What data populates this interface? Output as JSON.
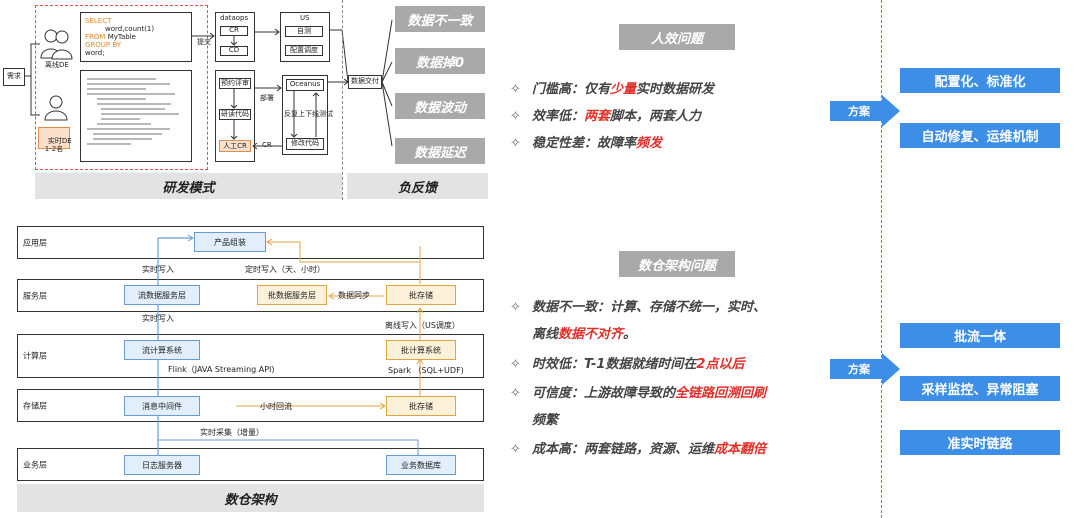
{
  "dev_mode": {
    "request": "需求",
    "offline_de": "离线DE",
    "realtime_de": "实时DE\n1-2名",
    "sql": {
      "l1": "SELECT",
      "l2": "word,count(1)",
      "l3": "FROM",
      "l3b": "MyTable",
      "l4": "GROUP BY",
      "l5": "word;"
    },
    "submit": "提交",
    "deploy": "部署",
    "dataops": "dataops",
    "cr": "CR",
    "cd": "CD",
    "us": "US",
    "self_test": "自测",
    "config_schedule": "配置调度",
    "pre_review": "预约评审",
    "study_code": "研读代码",
    "manual_cr": "人工CR",
    "cr_arrow": "CR",
    "oceanus": "Oceanus",
    "updown_test": "反复上下线测试",
    "modify_code": "修改代码",
    "data_delivery": "数据交付",
    "caption": "研发模式"
  },
  "negative_feedback": {
    "items": [
      "数据不一致",
      "数据掉0",
      "数据波动",
      "数据延迟"
    ],
    "caption": "负反馈"
  },
  "architecture": {
    "layers": [
      "应用层",
      "服务层",
      "计算层",
      "存储层",
      "业务层"
    ],
    "product_assembly": "产品组装",
    "stream_service": "流数据服务层",
    "batch_service": "批数据服务层",
    "batch_storage_top": "批存储",
    "stream_compute": "流计算系统",
    "batch_compute": "批计算系统",
    "message_middleware": "消息中间件",
    "batch_storage_bottom": "批存储",
    "log_server": "日志服务器",
    "biz_db": "业务数据库",
    "realtime_write_1": "实时写入",
    "scheduled_write": "定时写入（天、小时）",
    "data_sync": "数据同步",
    "realtime_write_2": "实时写入",
    "offline_write": "离线写入（US调度）",
    "flink": "Flink（JAVA Streaming API)",
    "spark": "Spark （SQL+UDF)",
    "hourly_backflow": "小时回流",
    "realtime_collect": "实时采集（增量）",
    "caption": "数仓架构"
  },
  "efficiency": {
    "title": "人效问题",
    "b1_pre": "门槛高：仅有",
    "b1_red": "少量",
    "b1_post": "实时数据研发",
    "b2_pre": "效率低：",
    "b2_red": "两套",
    "b2_post": "脚本，两套人力",
    "b3_pre": "稳定性差：故障率",
    "b3_red": "频发"
  },
  "dw_problems": {
    "title": "数仓架构问题",
    "b1_l1": "数据不一致：计算、存储不统一，实时、",
    "b1_l2_pre": "离线",
    "b1_l2_red": "数据不对齐",
    "b1_l2_post": "。",
    "b2_pre": "时效低：T-1数据就绪时间在",
    "b2_red": "2点以后",
    "b3_pre": "可信度：上游故障导致的",
    "b3_red": "全链路回溯回刷",
    "b3_l2": "频繁",
    "b4_pre": "成本高：两套链路，资源、运维",
    "b4_red": "成本翻倍"
  },
  "solutions": {
    "arrow_label_1": "方案",
    "arrow_label_2": "方案",
    "top": [
      "配置化、标准化",
      "自动修复、运维机制"
    ],
    "bottom": [
      "批流一体",
      "采样监控、异常阻塞",
      "准实时链路"
    ]
  },
  "colors": {
    "accent_red": "#e0302a",
    "chip_grey": "#a9a9a9",
    "chip_blue": "#3d8ee6",
    "divider_blue": "#3d8ee6"
  }
}
